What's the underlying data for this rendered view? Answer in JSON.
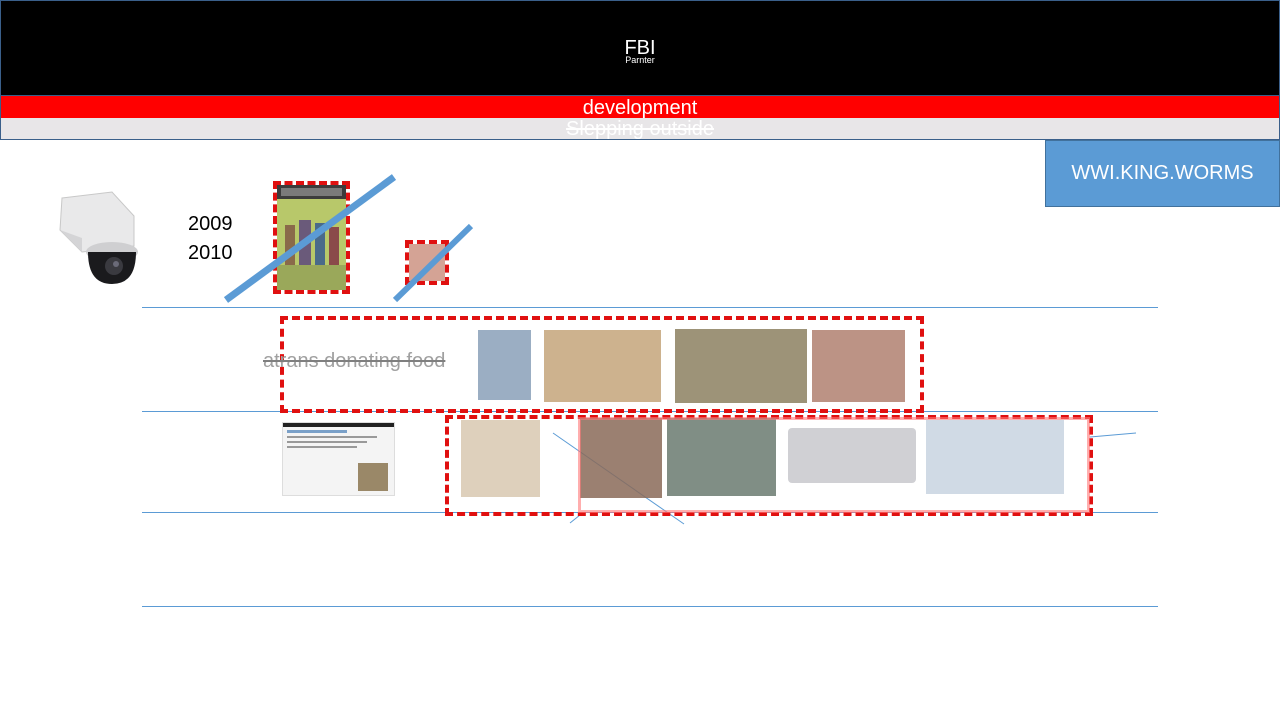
{
  "header": {
    "title": "FBI",
    "subtitle": "Parnter"
  },
  "band_red": {
    "text": "development"
  },
  "band_grey": {
    "text": "Slepping outside"
  },
  "callout": {
    "text": "WWI.KING.WORMS"
  },
  "years": [
    "2009",
    "2010"
  ],
  "row2": {
    "text": "atrans donating food"
  },
  "colors": {
    "header_bg": "#000000",
    "band_red": "#ff0000",
    "band_grey": "#e8e6e8",
    "callout_bg": "#5b9bd5",
    "dash_red": "#e01010",
    "line_blue": "#5b9bd5"
  },
  "icons": [
    "security-camera-icon",
    "book-cover-image",
    "photo-thumbnails",
    "news-article-thumbnail"
  ]
}
